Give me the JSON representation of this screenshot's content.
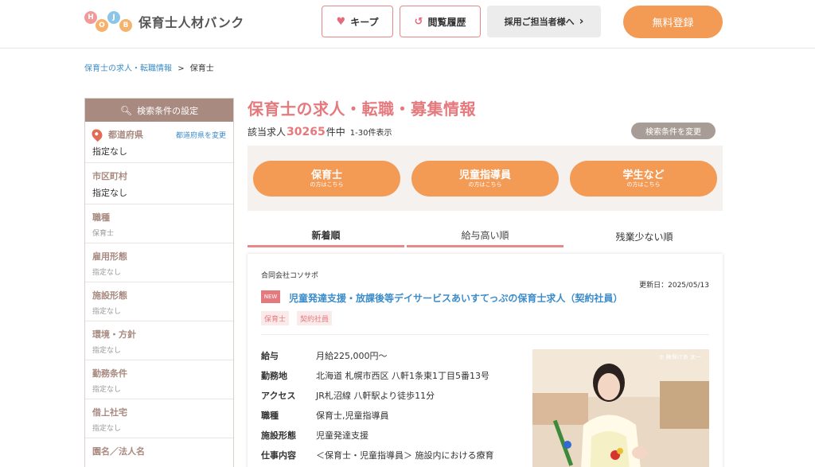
{
  "header": {
    "logo_letters": [
      "H",
      "O",
      "J",
      "B"
    ],
    "logo_name": "保育士人材バンク",
    "keep_label": "キープ",
    "history_label": "閲覧履歴",
    "corp_label": "採用ご担当者様へ",
    "register_label": "無料登録"
  },
  "breadcrumb": {
    "link": "保育士の求人・転職情報",
    "separator": ">",
    "current": "保育士"
  },
  "sidebar": {
    "heading": "検索条件の設定",
    "sections": [
      {
        "label": "都道府県",
        "link": "都道府県を変更",
        "value": "指定なし"
      },
      {
        "label": "市区町村",
        "value": "指定なし"
      },
      {
        "label": "職種",
        "value": "保育士"
      },
      {
        "label": "雇用形態",
        "value": "指定なし"
      },
      {
        "label": "施設形態",
        "value": "指定なし"
      },
      {
        "label": "環境・方針",
        "value": "指定なし"
      },
      {
        "label": "勤務条件",
        "value": "指定なし"
      },
      {
        "label": "借上社宅",
        "value": "指定なし"
      },
      {
        "label": "園名／法人名",
        "value": ""
      }
    ]
  },
  "main": {
    "title": "保育士の求人・転職・募集情報",
    "count_prefix": "該当求人",
    "count": "30265",
    "count_suffix": "件中",
    "range": "1-30件表示",
    "change_button": "検索条件を変更",
    "categories": [
      {
        "label": "保育士",
        "sub": "の方はこちら"
      },
      {
        "label": "児童指導員",
        "sub": "の方はこちら"
      },
      {
        "label": "学生など",
        "sub": "の方はこちら"
      }
    ],
    "sort_tabs": [
      "新着順",
      "給与高い順",
      "残業少ない順"
    ]
  },
  "job": {
    "company": "合同会社コソサポ",
    "updated": "更新日：2025/05/13",
    "new_badge": "NEW",
    "title": "児童発達支援・放課後等デイサービスあいすてっぷの保育士求人（契約社員）",
    "tags": [
      "保育士",
      "契約社員"
    ],
    "details": [
      {
        "key": "給与",
        "value": "月給225,000円〜"
      },
      {
        "key": "勤務地",
        "value": "北海道 札幌市西区 八軒1条東1丁目5番13号"
      },
      {
        "key": "アクセス",
        "value": "JR札沼線 八軒駅より徒歩11分"
      },
      {
        "key": "職種",
        "value": "保育士,児童指導員"
      },
      {
        "key": "施設形態",
        "value": "児童発達支援"
      },
      {
        "key": "仕事内容",
        "value": "＜保育士・児童指導員＞ 施設内における療育"
      }
    ],
    "photo_caption": "ホ 梅保けあ 太一 "
  },
  "colors": {
    "accent": "#e57a7e",
    "orange": "#f39a55",
    "sidebar_head": "#a88a80",
    "link": "#3b8cc9"
  }
}
